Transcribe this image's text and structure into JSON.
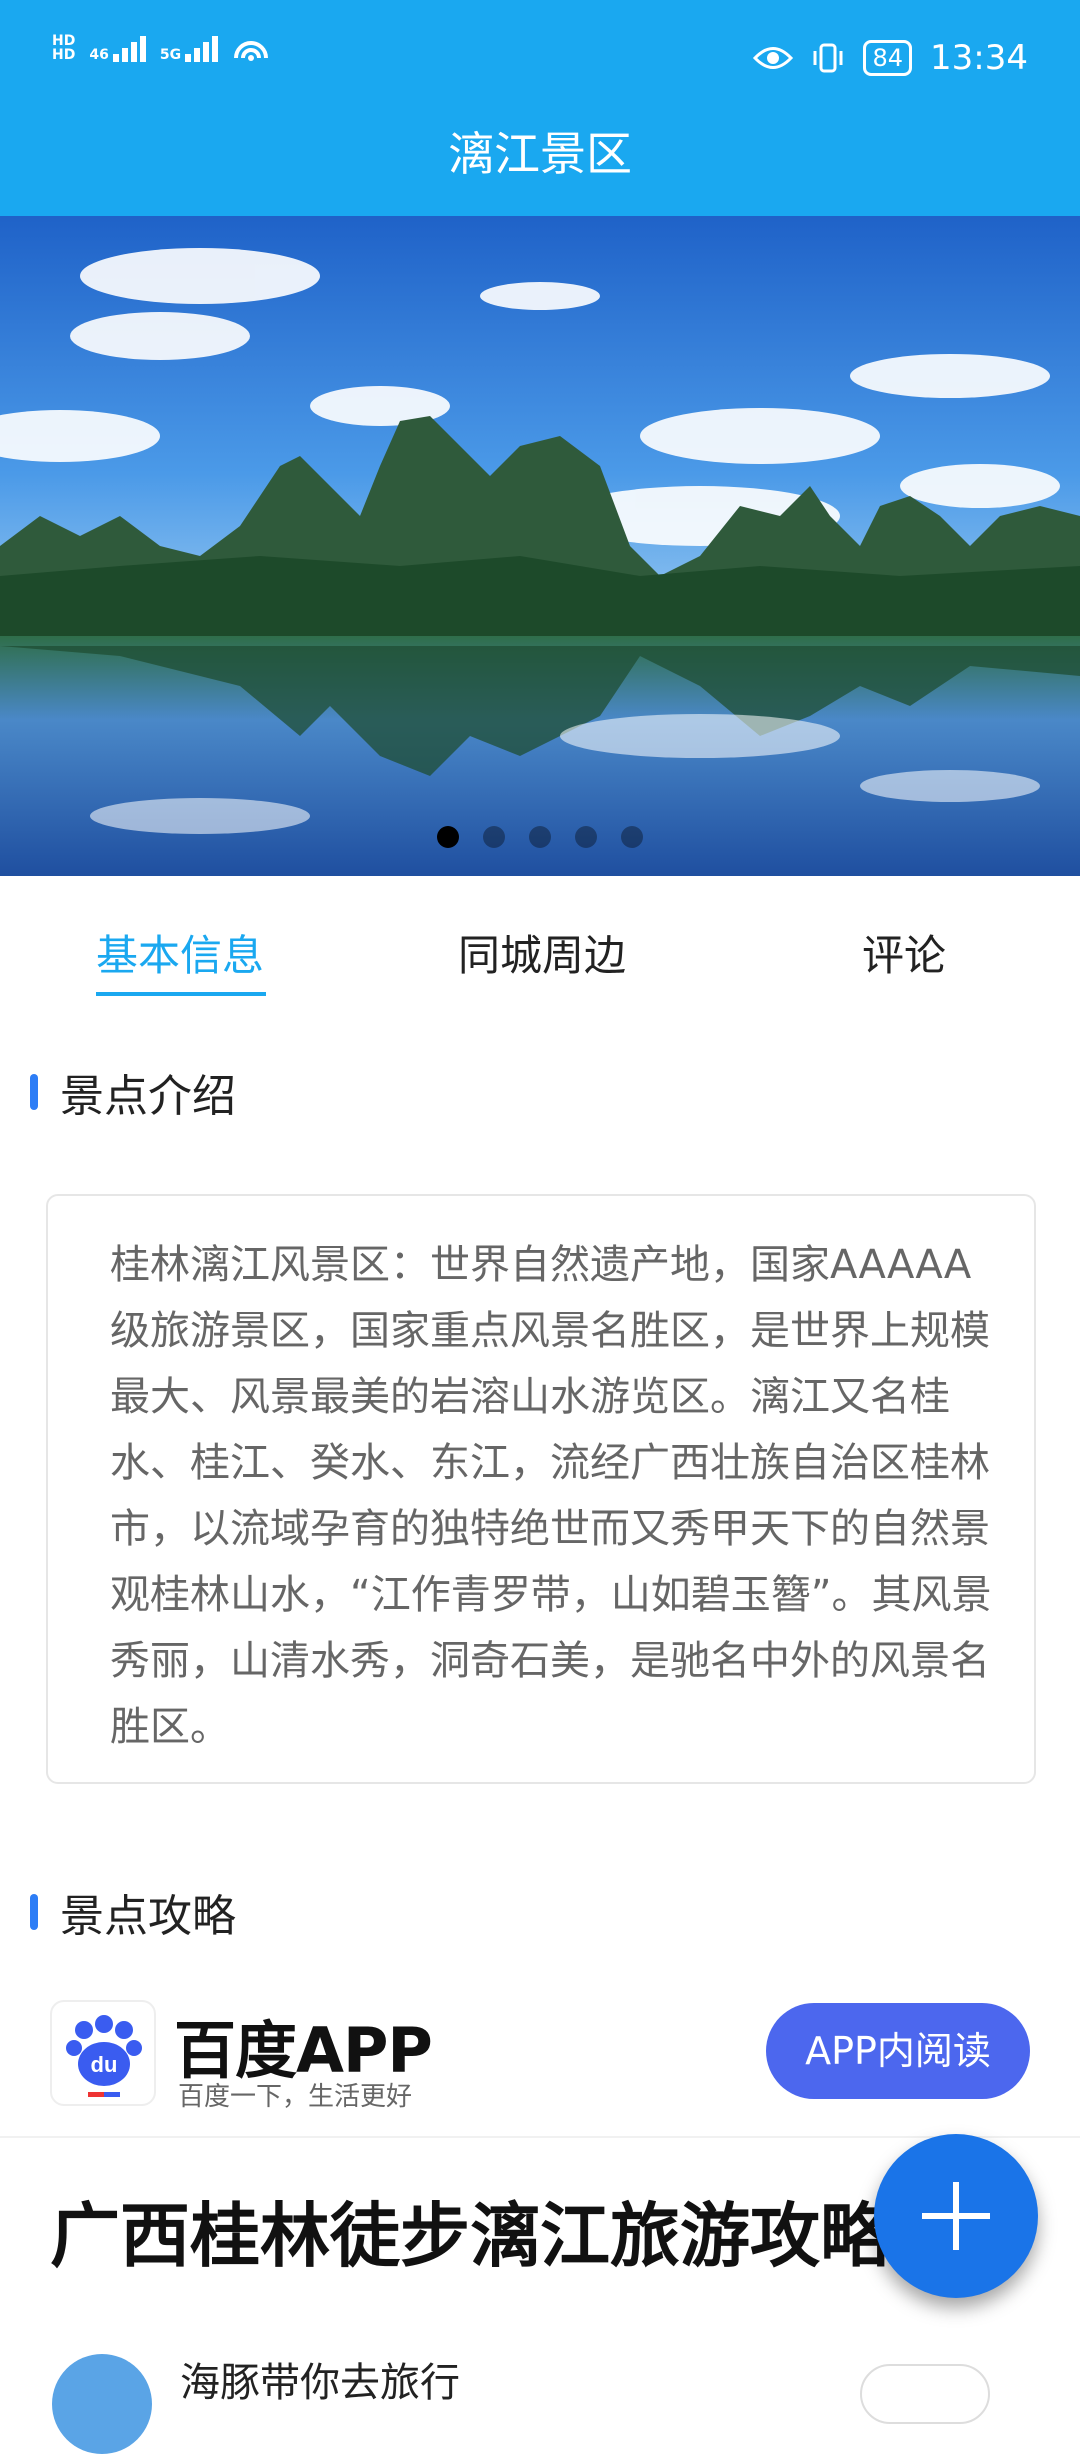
{
  "status_bar": {
    "left_labels": [
      "HD",
      "46",
      "5G"
    ],
    "battery": "84",
    "time": "13:34"
  },
  "header": {
    "title": "漓江景区"
  },
  "banner": {
    "image": "guilin-landscape-image",
    "dots": 5,
    "active_dot": 0
  },
  "tabs": [
    {
      "label": "基本信息",
      "active": true
    },
    {
      "label": "同城周边",
      "active": false
    },
    {
      "label": "评论",
      "active": false
    }
  ],
  "intro": {
    "heading": "景点介绍",
    "text": "桂林漓江风景区：世界自然遗产地，国家AAAAA级旅游景区，国家重点风景名胜区，是世界上规模最大、风景最美的岩溶山水游览区。漓江又名桂水、桂江、癸水、东江，流经广西壮族自治区桂林市，以流域孕育的独特绝世而又秀甲天下的自然景观桂林山水，“江作青罗带，山如碧玉簪”。其风景秀丽，山清水秀，洞奇石美，是驰名中外的风景名胜区。"
  },
  "guide": {
    "heading": "景点攻略",
    "ad_brand": "百度APP",
    "ad_slogan": "百度一下，生活更好",
    "read_button": "APP内阅读",
    "article_title": "广西桂林徒步漓江旅游攻略",
    "author": "海豚带你去旅行"
  },
  "fab": {
    "icon": "plus-icon"
  },
  "colors": {
    "primary": "#1aa8f0",
    "section_bar": "#2d7df6",
    "read_button": "#4c67ee",
    "fab": "#1a74e8"
  }
}
